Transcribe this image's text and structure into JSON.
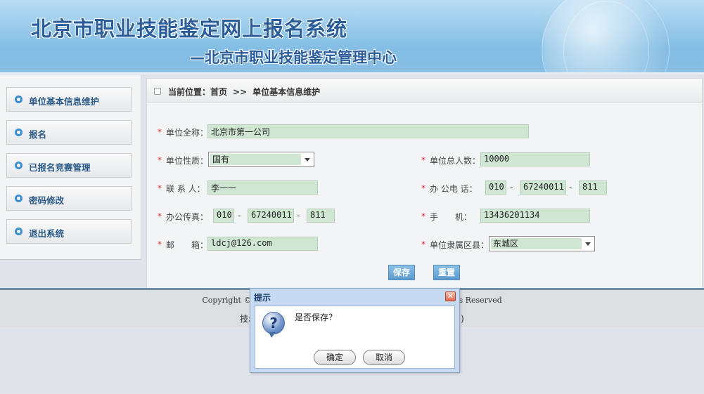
{
  "header": {
    "title": "北京市职业技能鉴定网上报名系统",
    "subtitle": "—北京市职业技能鉴定管理中心"
  },
  "sidebar": {
    "items": [
      {
        "label": "单位基本信息维护"
      },
      {
        "label": "报名"
      },
      {
        "label": "已报名竞赛管理"
      },
      {
        "label": "密码修改"
      },
      {
        "label": "退出系统"
      }
    ]
  },
  "breadcrumb": {
    "prefix": "当前位置：首页",
    "separator": ">>",
    "current": "单位基本信息维护"
  },
  "form": {
    "star": "*",
    "dash": "-",
    "unit_name": {
      "label": "单位全称：",
      "value": "北京市第一公司"
    },
    "unit_type": {
      "label": "单位性质：",
      "value": "国有"
    },
    "total_staff": {
      "label": "单位总人数：",
      "value": "10000"
    },
    "contact": {
      "label": "联 系 人：",
      "value": "李一一"
    },
    "office_phone": {
      "label": "办 公电 话：",
      "area": "010",
      "number": "67240011",
      "ext": "811"
    },
    "office_fax": {
      "label": "办公传真：",
      "area": "010",
      "number": "67240011",
      "ext": "811"
    },
    "mobile": {
      "label": "手　　机：",
      "value": "13436201134"
    },
    "email": {
      "label": "邮　　箱：",
      "value": "ldcj@126.com"
    },
    "district": {
      "label": "单位隶属区县：",
      "value": "东城区"
    },
    "save_label": "保存",
    "reset_label": "重置"
  },
  "footer": {
    "copyright_start": "Copyright © 2012",
    "copyright_end": "ghts Reserved",
    "support_start": "技术",
    "support_end": ")"
  },
  "dialog": {
    "title": "提示",
    "close_glyph": "✕",
    "icon_glyph": "?",
    "message": "是否保存？",
    "ok_label": "确定",
    "cancel_label": "取消"
  },
  "colors": {
    "field_bg": "#cfe6d3",
    "accent_blue": "#2b5a86",
    "required_star": "#dd3333"
  }
}
